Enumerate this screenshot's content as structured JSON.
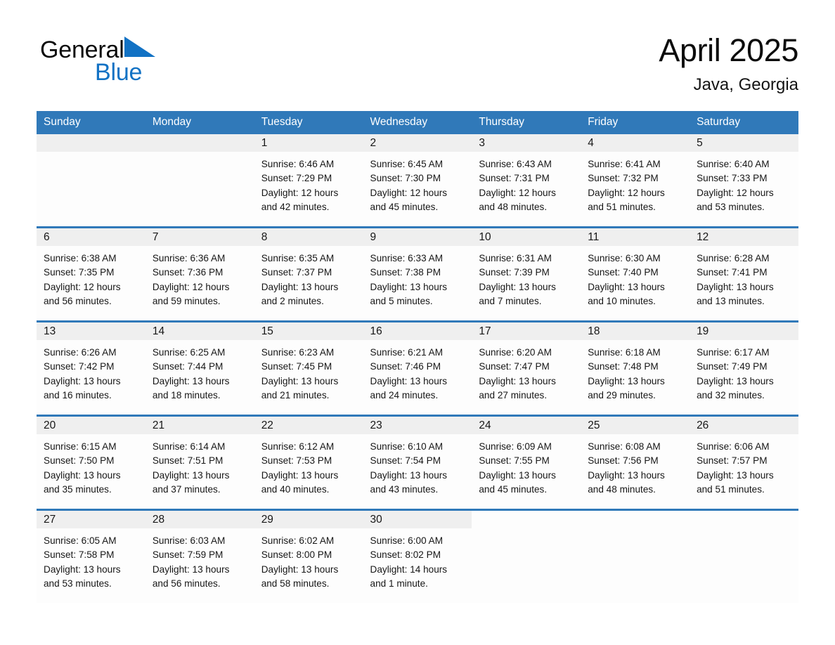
{
  "brand": {
    "word_general": "General",
    "word_blue": "Blue",
    "triangle_color": "#1272c4"
  },
  "header": {
    "month_title": "April 2025",
    "location": "Java, Georgia"
  },
  "theme": {
    "header_blue": "#3079b9",
    "daynum_band": "#efefef",
    "cell_bg": "#fdfdfd",
    "text": "#161616"
  },
  "calendar": {
    "weekday_headers": [
      "Sunday",
      "Monday",
      "Tuesday",
      "Wednesday",
      "Thursday",
      "Friday",
      "Saturday"
    ],
    "weeks": [
      [
        {
          "day": "",
          "blank": true
        },
        {
          "day": "",
          "blank": true
        },
        {
          "day": "1",
          "sunrise": "Sunrise: 6:46 AM",
          "sunset": "Sunset: 7:29 PM",
          "daylight_1": "Daylight: 12 hours",
          "daylight_2": "and 42 minutes."
        },
        {
          "day": "2",
          "sunrise": "Sunrise: 6:45 AM",
          "sunset": "Sunset: 7:30 PM",
          "daylight_1": "Daylight: 12 hours",
          "daylight_2": "and 45 minutes."
        },
        {
          "day": "3",
          "sunrise": "Sunrise: 6:43 AM",
          "sunset": "Sunset: 7:31 PM",
          "daylight_1": "Daylight: 12 hours",
          "daylight_2": "and 48 minutes."
        },
        {
          "day": "4",
          "sunrise": "Sunrise: 6:41 AM",
          "sunset": "Sunset: 7:32 PM",
          "daylight_1": "Daylight: 12 hours",
          "daylight_2": "and 51 minutes."
        },
        {
          "day": "5",
          "sunrise": "Sunrise: 6:40 AM",
          "sunset": "Sunset: 7:33 PM",
          "daylight_1": "Daylight: 12 hours",
          "daylight_2": "and 53 minutes."
        }
      ],
      [
        {
          "day": "6",
          "sunrise": "Sunrise: 6:38 AM",
          "sunset": "Sunset: 7:35 PM",
          "daylight_1": "Daylight: 12 hours",
          "daylight_2": "and 56 minutes."
        },
        {
          "day": "7",
          "sunrise": "Sunrise: 6:36 AM",
          "sunset": "Sunset: 7:36 PM",
          "daylight_1": "Daylight: 12 hours",
          "daylight_2": "and 59 minutes."
        },
        {
          "day": "8",
          "sunrise": "Sunrise: 6:35 AM",
          "sunset": "Sunset: 7:37 PM",
          "daylight_1": "Daylight: 13 hours",
          "daylight_2": "and 2 minutes."
        },
        {
          "day": "9",
          "sunrise": "Sunrise: 6:33 AM",
          "sunset": "Sunset: 7:38 PM",
          "daylight_1": "Daylight: 13 hours",
          "daylight_2": "and 5 minutes."
        },
        {
          "day": "10",
          "sunrise": "Sunrise: 6:31 AM",
          "sunset": "Sunset: 7:39 PM",
          "daylight_1": "Daylight: 13 hours",
          "daylight_2": "and 7 minutes."
        },
        {
          "day": "11",
          "sunrise": "Sunrise: 6:30 AM",
          "sunset": "Sunset: 7:40 PM",
          "daylight_1": "Daylight: 13 hours",
          "daylight_2": "and 10 minutes."
        },
        {
          "day": "12",
          "sunrise": "Sunrise: 6:28 AM",
          "sunset": "Sunset: 7:41 PM",
          "daylight_1": "Daylight: 13 hours",
          "daylight_2": "and 13 minutes."
        }
      ],
      [
        {
          "day": "13",
          "sunrise": "Sunrise: 6:26 AM",
          "sunset": "Sunset: 7:42 PM",
          "daylight_1": "Daylight: 13 hours",
          "daylight_2": "and 16 minutes."
        },
        {
          "day": "14",
          "sunrise": "Sunrise: 6:25 AM",
          "sunset": "Sunset: 7:44 PM",
          "daylight_1": "Daylight: 13 hours",
          "daylight_2": "and 18 minutes."
        },
        {
          "day": "15",
          "sunrise": "Sunrise: 6:23 AM",
          "sunset": "Sunset: 7:45 PM",
          "daylight_1": "Daylight: 13 hours",
          "daylight_2": "and 21 minutes."
        },
        {
          "day": "16",
          "sunrise": "Sunrise: 6:21 AM",
          "sunset": "Sunset: 7:46 PM",
          "daylight_1": "Daylight: 13 hours",
          "daylight_2": "and 24 minutes."
        },
        {
          "day": "17",
          "sunrise": "Sunrise: 6:20 AM",
          "sunset": "Sunset: 7:47 PM",
          "daylight_1": "Daylight: 13 hours",
          "daylight_2": "and 27 minutes."
        },
        {
          "day": "18",
          "sunrise": "Sunrise: 6:18 AM",
          "sunset": "Sunset: 7:48 PM",
          "daylight_1": "Daylight: 13 hours",
          "daylight_2": "and 29 minutes."
        },
        {
          "day": "19",
          "sunrise": "Sunrise: 6:17 AM",
          "sunset": "Sunset: 7:49 PM",
          "daylight_1": "Daylight: 13 hours",
          "daylight_2": "and 32 minutes."
        }
      ],
      [
        {
          "day": "20",
          "sunrise": "Sunrise: 6:15 AM",
          "sunset": "Sunset: 7:50 PM",
          "daylight_1": "Daylight: 13 hours",
          "daylight_2": "and 35 minutes."
        },
        {
          "day": "21",
          "sunrise": "Sunrise: 6:14 AM",
          "sunset": "Sunset: 7:51 PM",
          "daylight_1": "Daylight: 13 hours",
          "daylight_2": "and 37 minutes."
        },
        {
          "day": "22",
          "sunrise": "Sunrise: 6:12 AM",
          "sunset": "Sunset: 7:53 PM",
          "daylight_1": "Daylight: 13 hours",
          "daylight_2": "and 40 minutes."
        },
        {
          "day": "23",
          "sunrise": "Sunrise: 6:10 AM",
          "sunset": "Sunset: 7:54 PM",
          "daylight_1": "Daylight: 13 hours",
          "daylight_2": "and 43 minutes."
        },
        {
          "day": "24",
          "sunrise": "Sunrise: 6:09 AM",
          "sunset": "Sunset: 7:55 PM",
          "daylight_1": "Daylight: 13 hours",
          "daylight_2": "and 45 minutes."
        },
        {
          "day": "25",
          "sunrise": "Sunrise: 6:08 AM",
          "sunset": "Sunset: 7:56 PM",
          "daylight_1": "Daylight: 13 hours",
          "daylight_2": "and 48 minutes."
        },
        {
          "day": "26",
          "sunrise": "Sunrise: 6:06 AM",
          "sunset": "Sunset: 7:57 PM",
          "daylight_1": "Daylight: 13 hours",
          "daylight_2": "and 51 minutes."
        }
      ],
      [
        {
          "day": "27",
          "sunrise": "Sunrise: 6:05 AM",
          "sunset": "Sunset: 7:58 PM",
          "daylight_1": "Daylight: 13 hours",
          "daylight_2": "and 53 minutes."
        },
        {
          "day": "28",
          "sunrise": "Sunrise: 6:03 AM",
          "sunset": "Sunset: 7:59 PM",
          "daylight_1": "Daylight: 13 hours",
          "daylight_2": "and 56 minutes."
        },
        {
          "day": "29",
          "sunrise": "Sunrise: 6:02 AM",
          "sunset": "Sunset: 8:00 PM",
          "daylight_1": "Daylight: 13 hours",
          "daylight_2": "and 58 minutes."
        },
        {
          "day": "30",
          "sunrise": "Sunrise: 6:00 AM",
          "sunset": "Sunset: 8:02 PM",
          "daylight_1": "Daylight: 14 hours",
          "daylight_2": "and 1 minute."
        },
        {
          "day": "",
          "blank": true
        },
        {
          "day": "",
          "blank": true
        },
        {
          "day": "",
          "blank": true
        }
      ]
    ]
  }
}
